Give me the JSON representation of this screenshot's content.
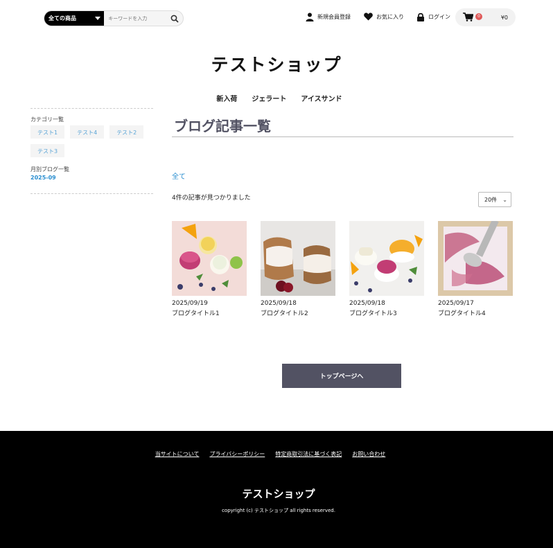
{
  "header": {
    "search_category": "全ての商品",
    "search_placeholder": "キーワードを入力",
    "signup_label": "新規会員登録",
    "favorites_label": "お気に入り",
    "login_label": "ログイン",
    "cart_count": "0",
    "cart_total": "¥0"
  },
  "shop_title": "テストショップ",
  "global_nav": [
    "新入荷",
    "ジェラート",
    "アイスサンド"
  ],
  "sidebar": {
    "category_heading": "カテゴリ一覧",
    "categories": [
      "テスト1",
      "テスト4",
      "テスト2",
      "テスト3"
    ],
    "monthly_heading": "月別ブログ一覧",
    "months": [
      "2025-09"
    ]
  },
  "main": {
    "title": "ブログ記事一覧",
    "filter_all": "全て",
    "result_count": "4件の記事が見つかりました",
    "per_page": "20件",
    "posts": [
      {
        "date": "2025/09/19",
        "title": "ブログタイトル1"
      },
      {
        "date": "2025/09/18",
        "title": "ブログタイトル2"
      },
      {
        "date": "2025/09/18",
        "title": "ブログタイトル3"
      },
      {
        "date": "2025/09/17",
        "title": "ブログタイトル4"
      }
    ],
    "top_button": "トップページへ"
  },
  "footer": {
    "links": [
      "当サイトについて",
      "プライバシーポリシー",
      "特定商取引法に基づく表記",
      "お問い合わせ"
    ],
    "title": "テストショップ",
    "copyright": "copyright (c) テストショップ all rights reserved."
  },
  "colors": {
    "accent": "#525263",
    "link": "#2a8ed0",
    "badge": "#e05a5a",
    "footer_bg": "#000000"
  }
}
